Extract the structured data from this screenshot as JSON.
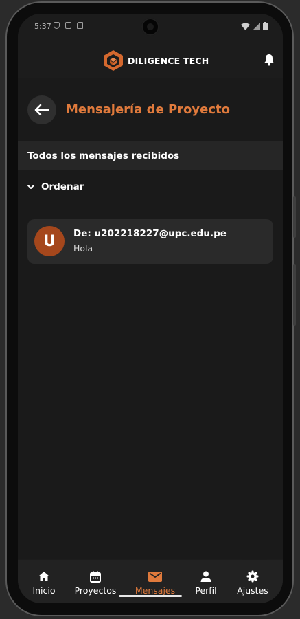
{
  "status_bar": {
    "time": "5:37"
  },
  "app_bar": {
    "brand_name": "DILIGENCE TECH"
  },
  "page": {
    "title": "Mensajería de Proyecto",
    "section_header": "Todos los mensajes recibidos",
    "sort_label": "Ordenar"
  },
  "messages": [
    {
      "avatar_letter": "U",
      "from": "De: u202218227@upc.edu.pe",
      "body": "Hola"
    }
  ],
  "bottom_nav": {
    "items": [
      {
        "label": "Inicio",
        "icon": "home-icon"
      },
      {
        "label": "Proyectos",
        "icon": "calendar-icon"
      },
      {
        "label": "Mensajes",
        "icon": "mail-icon",
        "active": true
      },
      {
        "label": "Perfil",
        "icon": "person-icon"
      },
      {
        "label": "Ajustes",
        "icon": "gear-icon"
      }
    ]
  },
  "colors": {
    "accent": "#e07a3c",
    "background": "#1a1a1a",
    "avatar": "#a5471c"
  }
}
